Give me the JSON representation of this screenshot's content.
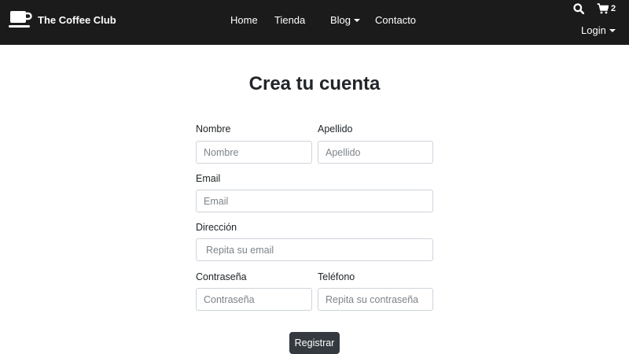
{
  "nav": {
    "brand": "The Coffee Club",
    "links": {
      "home": "Home",
      "shop": "Tienda",
      "blog": "Blog",
      "contact": "Contacto"
    },
    "cart_count": "2",
    "login": "Login"
  },
  "form": {
    "title": "Crea tu cuenta",
    "first_name": {
      "label": "Nombre",
      "placeholder": "Nombre"
    },
    "last_name": {
      "label": "Apellido",
      "placeholder": "Apellido"
    },
    "email": {
      "label": "Email",
      "placeholder": "Email"
    },
    "address": {
      "label": "Dirección",
      "placeholder": "Repita su email"
    },
    "password": {
      "label": "Contraseña",
      "placeholder": "Contraseña"
    },
    "phone": {
      "label": "Teléfono",
      "placeholder": "Repita su contraseña"
    },
    "submit": "Registrar"
  },
  "colors": {
    "navbar_bg": "#1b1b1b",
    "button_bg": "#343a40",
    "input_border": "#ced4da"
  },
  "icons": [
    "coffee-cup-icon",
    "search-icon",
    "cart-icon",
    "caret-down-icon"
  ]
}
